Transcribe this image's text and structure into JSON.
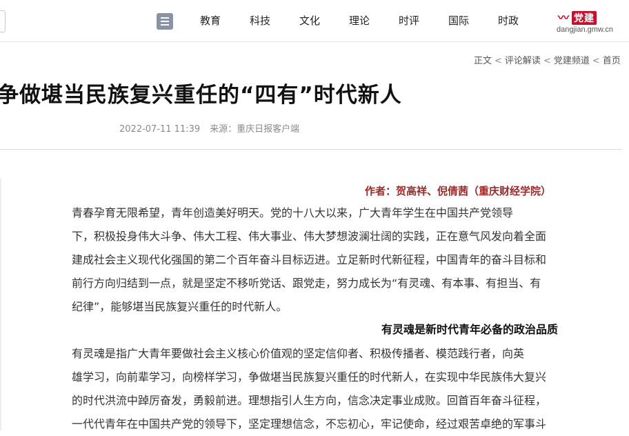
{
  "header": {
    "logo_mark": "党建",
    "logo_domain": "dangjian.gmw.cn",
    "nav": [
      "时政",
      "国际",
      "时评",
      "理论",
      "文化",
      "科技",
      "教育"
    ]
  },
  "breadcrumb": {
    "home": "首页",
    "channel": "党建频道",
    "section": "评论解读",
    "current": "正文"
  },
  "article": {
    "title": "争做堪当民族复兴重任的“四有”时代新人",
    "source": "来源：重庆日报客户端",
    "timestamp": "2022-07-11 11:39",
    "author": "作者：贺高祥、倪倩茜（重庆财经学院）",
    "para1": [
      "青春孕育无限希望，青年创造美好明天。党的十八大以来，广大青年学生在中国共产党领导",
      "下，积极投身伟大斗争、伟大工程、伟大事业、伟大梦想波澜壮阔的实践，正在意气风发向着全面",
      "建成社会主义现代化强国的第二个百年奋斗目标迈进。立足新时代新征程，中国青年的奋斗目标和",
      "前行方向归结到一点，就是坚定不移听党话、跟党走，努力成长为“有灵魂、有本事、有担当、有",
      "纪律”，能够堪当民族复兴重任的时代新人。"
    ],
    "subhead1": "有灵魂是新时代青年必备的政治品质",
    "para2": [
      "有灵魂是指广大青年要做社会主义核心价值观的坚定信仰者、积极传播者、模范践行者，向英",
      "雄学习，向前辈学习，向榜样学习，争做堪当民族复兴重任的时代新人，在实现中华民族伟大复兴",
      "的时代洪流中踔厉奋发，勇毅前进。理想指引人生方向，信念决定事业成败。回首百年奋斗征程，",
      "一代代青年在中国共产党的领导下，坚定理想信念，不忘初心，牢记使命，经过艰苦卓绝的军事斗"
    ]
  }
}
